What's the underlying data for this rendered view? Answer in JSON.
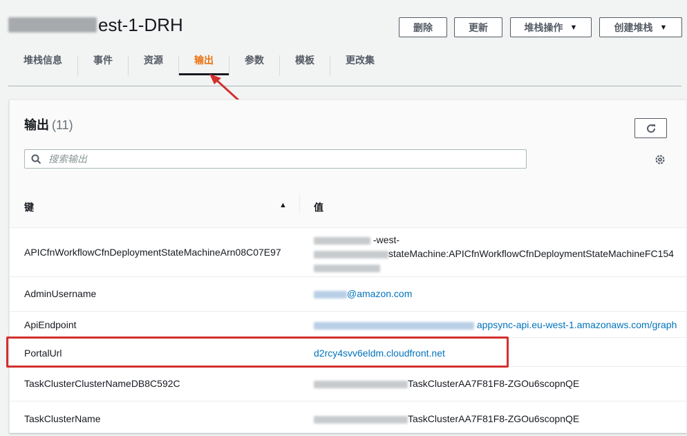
{
  "header": {
    "title_suffix": "est-1-DRH",
    "buttons": {
      "delete": "删除",
      "update": "更新",
      "stack_actions": "堆栈操作",
      "create_stack": "创建堆栈"
    }
  },
  "tabs": [
    "堆栈信息",
    "事件",
    "资源",
    "输出",
    "参数",
    "模板",
    "更改集"
  ],
  "active_tab": "输出",
  "panel": {
    "title": "输出",
    "count": "(11)",
    "search_placeholder": "搜索输出",
    "columns": {
      "key": "键",
      "value": "值"
    }
  },
  "rows": [
    {
      "key": "APICfnWorkflowCfnDeploymentStateMachineArn08C07E97",
      "value_line1": "-west-",
      "value_line2": "stateMachine:APICfnWorkflowCfnDeploymentStateMachineFC154"
    },
    {
      "key": "AdminUsername",
      "value": "@amazon.com"
    },
    {
      "key": "ApiEndpoint",
      "value": "appsync-api.eu-west-1.amazonaws.com/graph"
    },
    {
      "key": "PortalUrl",
      "value": "d2rcy4svv6eldm.cloudfront.net"
    },
    {
      "key": "TaskClusterClusterNameDB8C592C",
      "value": "TaskClusterAA7F81F8-ZGOu6scopnQE"
    },
    {
      "key": "TaskClusterName",
      "value": "TaskClusterAA7F81F8-ZGOu6scopnQE"
    }
  ],
  "colors": {
    "accent": "#ec7211",
    "link": "#0073bb",
    "annotation": "#d32f2f"
  },
  "icons": [
    "search-icon",
    "refresh-icon",
    "gear-icon",
    "sort-ascending-icon",
    "caret-down-icon"
  ]
}
